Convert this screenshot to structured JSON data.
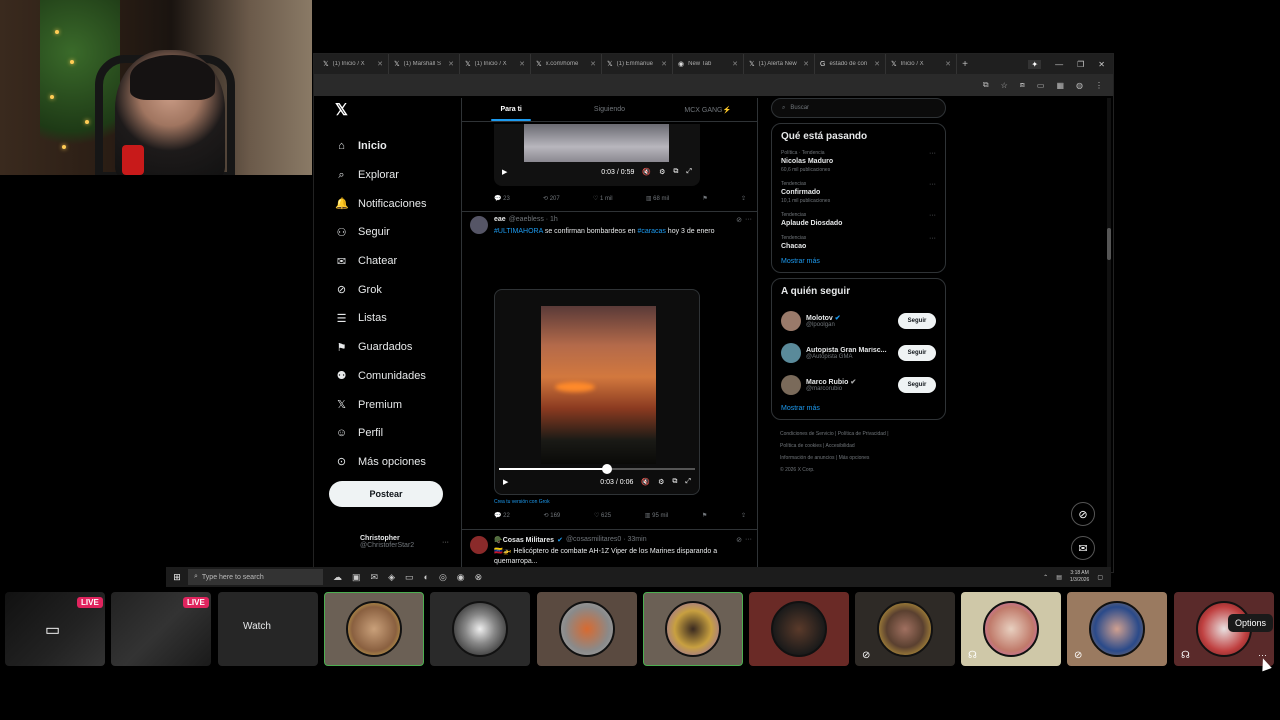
{
  "browser": {
    "tabs": [
      {
        "label": "(1) Inicio / X"
      },
      {
        "label": "(1) Marshall S"
      },
      {
        "label": "(1) Inicio / X"
      },
      {
        "label": "x.com/home"
      },
      {
        "label": "(1) Emmanue"
      },
      {
        "label": "New Tab"
      },
      {
        "label": "(1) Alerta New"
      },
      {
        "label": "estado de con"
      },
      {
        "label": "Inicio / X"
      }
    ]
  },
  "nav": {
    "logo": "X",
    "items": [
      {
        "label": "Inicio",
        "icon": "home-icon"
      },
      {
        "label": "Explorar",
        "icon": "search-icon"
      },
      {
        "label": "Notificaciones",
        "icon": "bell-icon"
      },
      {
        "label": "Seguir",
        "icon": "add-user-icon"
      },
      {
        "label": "Chatear",
        "icon": "mail-icon"
      },
      {
        "label": "Grok",
        "icon": "grok-icon"
      },
      {
        "label": "Listas",
        "icon": "list-icon"
      },
      {
        "label": "Guardados",
        "icon": "bookmark-icon"
      },
      {
        "label": "Comunidades",
        "icon": "people-icon"
      },
      {
        "label": "Premium",
        "icon": "x-icon"
      },
      {
        "label": "Perfil",
        "icon": "person-icon"
      },
      {
        "label": "Más opciones",
        "icon": "more-circle-icon"
      }
    ],
    "post_button": "Postear",
    "profile": {
      "name": "Christopher",
      "handle": "@ChristoferStar2"
    }
  },
  "timeline": {
    "tabs": [
      "Para ti",
      "Siguiendo",
      "MCX GANG⚡"
    ],
    "post1": {
      "time": "0:03 / 0:59",
      "actions": {
        "replies": "23",
        "reposts": "207",
        "likes": "1 mil",
        "views": "68 mil"
      }
    },
    "post2": {
      "name": "eae",
      "handle": "@eaebless · 1h",
      "hashtag1": "#ULTIMAHORA",
      "text1": " se confirman bombardeos en ",
      "hashtag2": "#caracas",
      "text2": " hoy 3 de enero",
      "time": "0:03 / 0:06",
      "progress": 0.55,
      "grok_link": "Crea tu versión con Grok",
      "actions": {
        "replies": "22",
        "reposts": "169",
        "likes": "625",
        "views": "95 mil"
      }
    },
    "post3": {
      "name": "🪖Cosas Militares",
      "handle": "@cosasmilitares0 · 33min",
      "text": "🇻🇪🚁 Helicóptero de combate AH-1Z Viper de los Marines disparando a quemarropa..."
    }
  },
  "right": {
    "search_placeholder": "Buscar",
    "trends_title": "Qué está pasando",
    "trends": [
      {
        "category": "Política · Tendencia",
        "title": "Nicolas Maduro",
        "count": "60,6 mil publicaciones"
      },
      {
        "category": "Tendencias",
        "title": "Confirmado",
        "count": "10,1 mil publicaciones"
      },
      {
        "category": "Tendencias",
        "title": "Aplaude Diosdado",
        "count": ""
      },
      {
        "category": "Tendencias",
        "title": "Chacao",
        "count": ""
      }
    ],
    "show_more": "Mostrar más",
    "follow_title": "A quién seguir",
    "follow": [
      {
        "name": "Molotov",
        "handle": "@lpoolgan"
      },
      {
        "name": "Autopista Gran Marisc...",
        "handle": "@Autopista GMA"
      },
      {
        "name": "Marco Rubio",
        "handle": "@marcorubio"
      }
    ],
    "follow_button": "Seguir",
    "footer": [
      "Condiciones de Servicio",
      "Política de Privacidad",
      "Política de cookies",
      "Accesibilidad",
      "Información de anuncios",
      "Más opciones",
      "© 2026 X Corp."
    ]
  },
  "taskbar": {
    "search_placeholder": "Type here to search",
    "time": "3:18 AM",
    "date": "1/3/2026"
  },
  "strip": {
    "live_label": "LIVE",
    "watch_label": "Watch",
    "options_label": "Options"
  },
  "colors": {
    "accent": "#1d9bf0",
    "live": "#e0245e",
    "selected_border": "#4caf50"
  }
}
